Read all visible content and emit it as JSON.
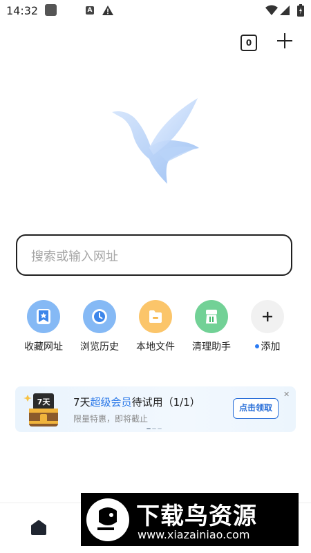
{
  "status_bar": {
    "time": "14:32",
    "icons": [
      "app-square-icon",
      "font-a-icon",
      "warning-icon",
      "wifi-icon",
      "cellular-icon",
      "battery-icon"
    ]
  },
  "top_bar": {
    "tab_count": "0",
    "add_icon": "plus-icon"
  },
  "search": {
    "placeholder": "搜索或输入网址"
  },
  "shortcuts": [
    {
      "label": "收藏网址",
      "icon": "bookmark-icon",
      "color": "#7cb4f5"
    },
    {
      "label": "浏览历史",
      "icon": "clock-icon",
      "color": "#7cb4f5"
    },
    {
      "label": "本地文件",
      "icon": "folder-icon",
      "color": "#fbc56a"
    },
    {
      "label": "清理助手",
      "icon": "broom-icon",
      "color": "#6fcf8f"
    },
    {
      "label": "添加",
      "icon": "plus-icon",
      "color": "#f1f1f1"
    }
  ],
  "promo": {
    "title_prefix": "7天",
    "title_highlight": "超级会员",
    "title_suffix": "待试用（1/1）",
    "subtitle": "限量特惠，即将截止",
    "button": "点击领取",
    "close": "✕",
    "chest_label": "7天",
    "accent": "#2a78e8"
  },
  "bottom_nav": {
    "home_icon": "home-icon"
  },
  "watermark": {
    "title": "下载鸟资源",
    "url": "www.xiazainiao.com"
  }
}
